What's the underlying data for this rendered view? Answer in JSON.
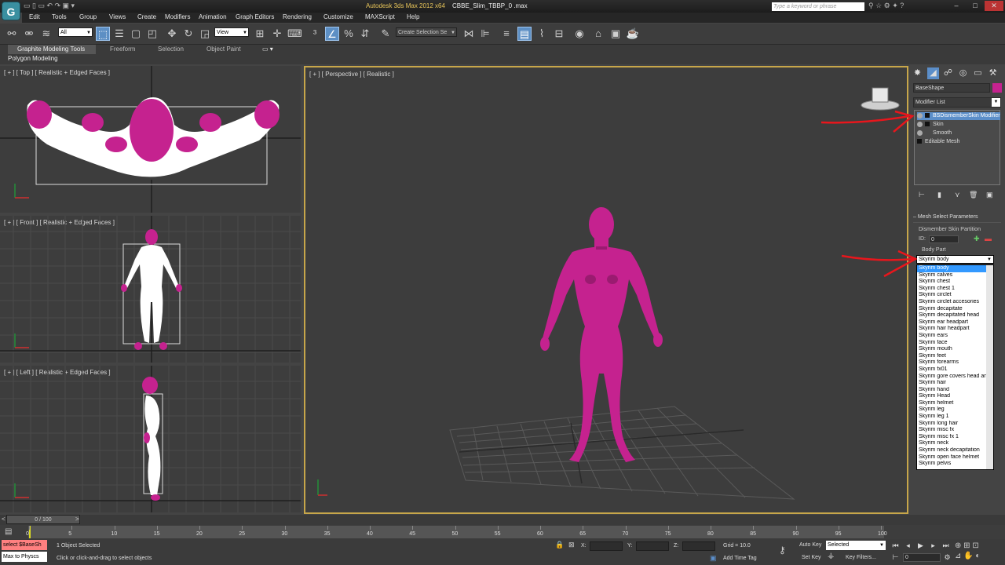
{
  "window": {
    "app_logo": "G",
    "title": "Autodesk 3ds Max  2012 x64",
    "file": "CBBE_Slim_TBBP_0 .max",
    "search_placeholder": "Type a keyword or phrase",
    "controls": [
      "–",
      "□",
      "✕"
    ]
  },
  "menu": [
    "Edit",
    "Tools",
    "Group",
    "Views",
    "Create",
    "Modifiers",
    "Animation",
    "Graph Editors",
    "Rendering",
    "Customize",
    "MAXScript",
    "Help"
  ],
  "toolbar": {
    "filter": "All",
    "coord": "View",
    "named_selection": "Create Selection Se"
  },
  "ribbon": {
    "tabs": [
      "Graphite Modeling Tools",
      "Freeform",
      "Selection",
      "Object Paint"
    ],
    "panel": "Polygon Modeling"
  },
  "viewports": {
    "top": "[ + ] [ Top ] [ Realistic + Edged Faces ]",
    "front": "[ + ] [ Front ] [ Realistic + Edged Faces ]",
    "left": "[ + ] [ Left ] [ Realistic + Edged Faces ]",
    "perspective": "[ + ] [ Perspective ] [ Realistic ]"
  },
  "command_panel": {
    "object_name": "BaseShape",
    "object_color": "#c5228f",
    "modifier_list": "Modifier List",
    "stack": [
      "BSDismemberSkin Modifier",
      "Skin",
      "Smooth",
      "Editable Mesh"
    ],
    "rollout": "Mesh Select Parameters",
    "dismember_label": "Dismember Skin Partition",
    "id_label": "ID:",
    "id_value": "0",
    "body_part_label": "Body Part",
    "body_part_value": "Skyrim body",
    "body_parts": [
      "Skyrim body",
      "Skyrim calves",
      "Skyrim chest",
      "Skyrim chest 1",
      "Skyrim circlet",
      "Skyrim circlet accesories",
      "Skyrim decapitate",
      "Skyrim decapitated head",
      "Skyrim ear headpart",
      "Skyrim hair headpart",
      "Skyrim ears",
      "Skyrim face",
      "Skyrim mouth",
      "Skyrim feet",
      "Skyrim forearms",
      "Skyrim fx01",
      "Skyrim gore covers head and hair",
      "Skyrim hair",
      "Skyrim hand",
      "Skyrim Head",
      "Skyrim helmet",
      "Skyrim leg",
      "Skyrim leg 1",
      "Skyrim long hair",
      "Skyrim misc fx",
      "Skyrim misc fx 1",
      "Skyrim neck",
      "Skyrim neck decapitation",
      "Skyrim open face helmet",
      "Skyrim pelvis"
    ]
  },
  "timeline": {
    "slider": "0 / 100",
    "ticks": [
      "0",
      "5",
      "10",
      "15",
      "20",
      "25",
      "30",
      "35",
      "40",
      "45",
      "50",
      "55",
      "60",
      "65",
      "70",
      "75",
      "80",
      "85",
      "90",
      "95",
      "100"
    ]
  },
  "status": {
    "maxscript_1": "select $BaseSh",
    "maxscript_2": "Max to Physcs",
    "selected_count": "1 Object Selected",
    "prompt": "Click or click-and-drag to select objects",
    "x_label": "X:",
    "y_label": "Y:",
    "z_label": "Z:",
    "grid": "Grid = 10.0",
    "add_time_tag": "Add Time Tag",
    "auto_key": "Auto Key",
    "set_key": "Set Key",
    "key_mode": "Selected",
    "key_filters": "Key Filters...",
    "frame": "0"
  },
  "colors": {
    "mesh": "#c5228f",
    "annotation_arrow": "#e8161c",
    "selection_blue": "#5b8ec9"
  }
}
